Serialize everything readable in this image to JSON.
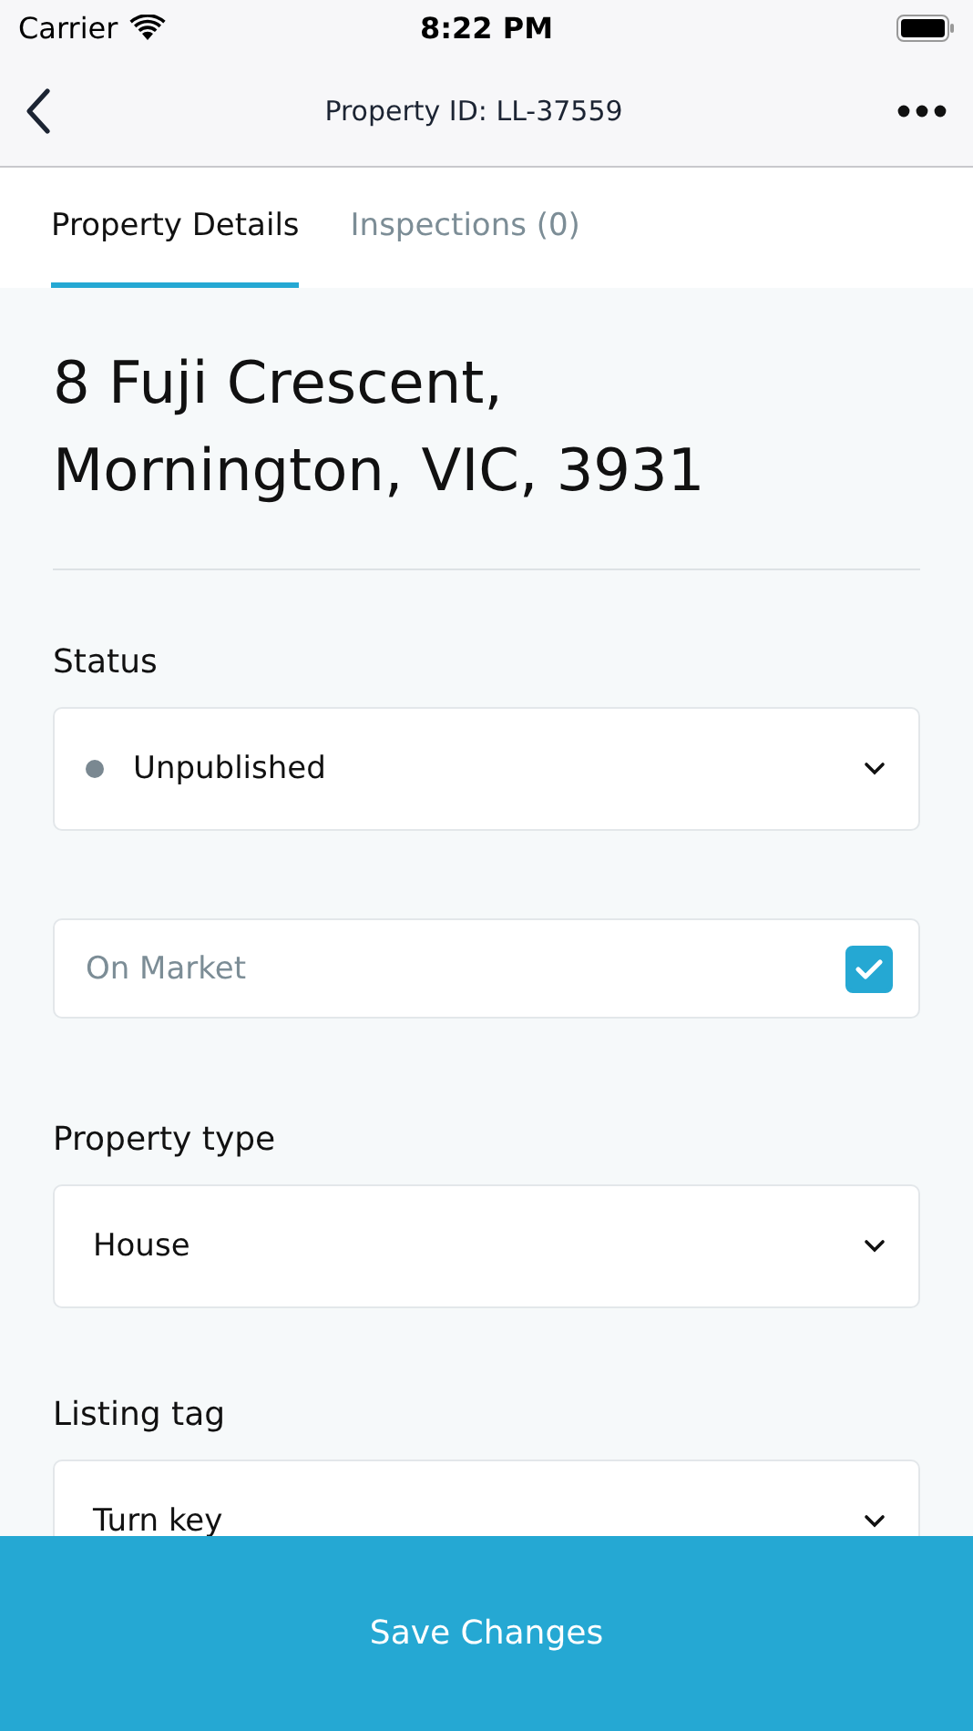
{
  "status_bar": {
    "carrier": "Carrier",
    "time": "8:22 PM"
  },
  "nav": {
    "title": "Property ID: LL-37559"
  },
  "tabs": [
    {
      "label": "Property Details",
      "selected": true
    },
    {
      "label": "Inspections (0)",
      "selected": false
    }
  ],
  "address": "8 Fuji Crescent, Mornington, VIC, 3931",
  "fields": [
    {
      "kind": "select",
      "label": "Status",
      "value": "Unpublished",
      "color": "#7a8891"
    },
    {
      "kind": "checkbox",
      "placeholder": "On Market",
      "checked": true
    },
    {
      "kind": "select",
      "label": "Property type",
      "value": "House"
    },
    {
      "kind": "select",
      "label": "Listing tag",
      "value": "Turn key"
    }
  ],
  "save_button": "Save Changes"
}
